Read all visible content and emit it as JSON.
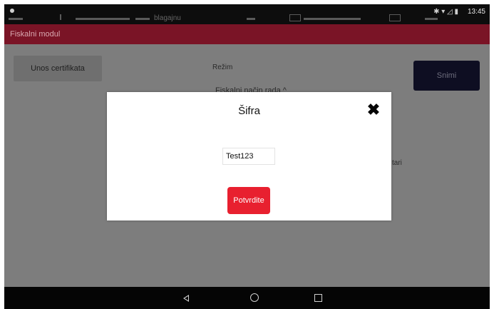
{
  "status_bar": {
    "tab_text": "blagajnu",
    "time": "13:45",
    "icons": "✱ ▾ ◿ ▮"
  },
  "app_bar": {
    "title": "Fiskalni modul"
  },
  "main": {
    "cert_button_label": "Unos certifikata",
    "mode_label": "Režim",
    "mode_value": "Fiskalni način rada ^",
    "save_button_label": "Snimi",
    "partial_text": "tari"
  },
  "dialog": {
    "title": "Šifra",
    "close_symbol": "✖",
    "password_value": "Test123",
    "confirm_label": "Potvrdite"
  },
  "nav_bar": {
    "back": "back",
    "home": "home",
    "recent": "recent-apps"
  },
  "colors": {
    "app_bar": "#7a1426",
    "accent_button": "#e8202f",
    "dim_overlay": "#7d7d7d"
  }
}
